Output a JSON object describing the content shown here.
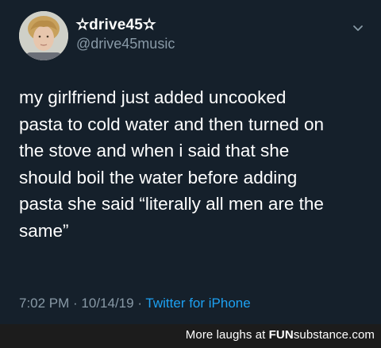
{
  "tweet": {
    "display_name": "✫drive45✫",
    "handle": "@drive45music",
    "text_lines": [
      "my girlfriend just added uncooked",
      "pasta to cold water and then turned on",
      "the stove and when i said that she",
      "should boil the water before adding",
      "pasta she said “literally all men are the",
      "same”"
    ],
    "time": "7:02 PM",
    "separator1": " · ",
    "date": "10/14/19",
    "separator2": " · ",
    "source": "Twitter for iPhone",
    "colors": {
      "background": "#15202b",
      "text": "#ffffff",
      "muted": "#8899a6",
      "link": "#1da1f2"
    },
    "icons": {
      "menu": "chevron-down-icon"
    }
  },
  "footer": {
    "prefix": "More laughs at ",
    "brand_bold": "FUN",
    "brand_rest": "substance.com",
    "background": "#1c1c1c"
  }
}
